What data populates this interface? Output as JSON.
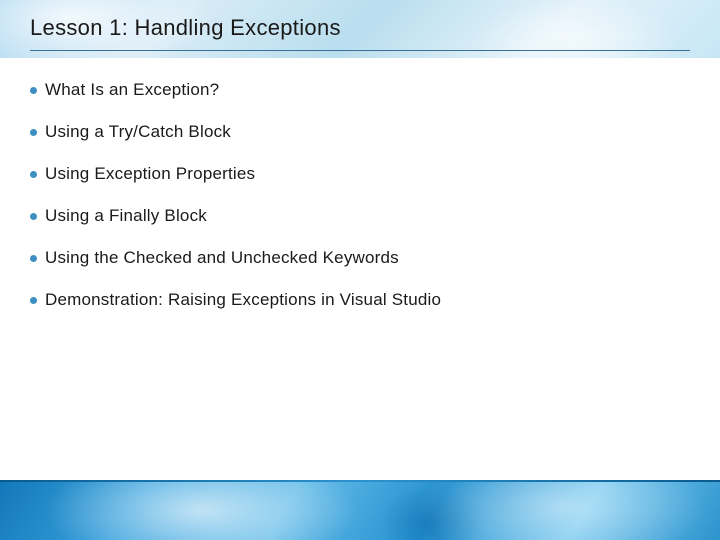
{
  "title": "Lesson 1: Handling Exceptions",
  "bullets": [
    "What Is an Exception?",
    "Using a Try/Catch Block",
    "Using Exception Properties",
    "Using a Finally Block",
    "Using the Checked and Unchecked Keywords",
    "Demonstration: Raising Exceptions in Visual Studio"
  ]
}
